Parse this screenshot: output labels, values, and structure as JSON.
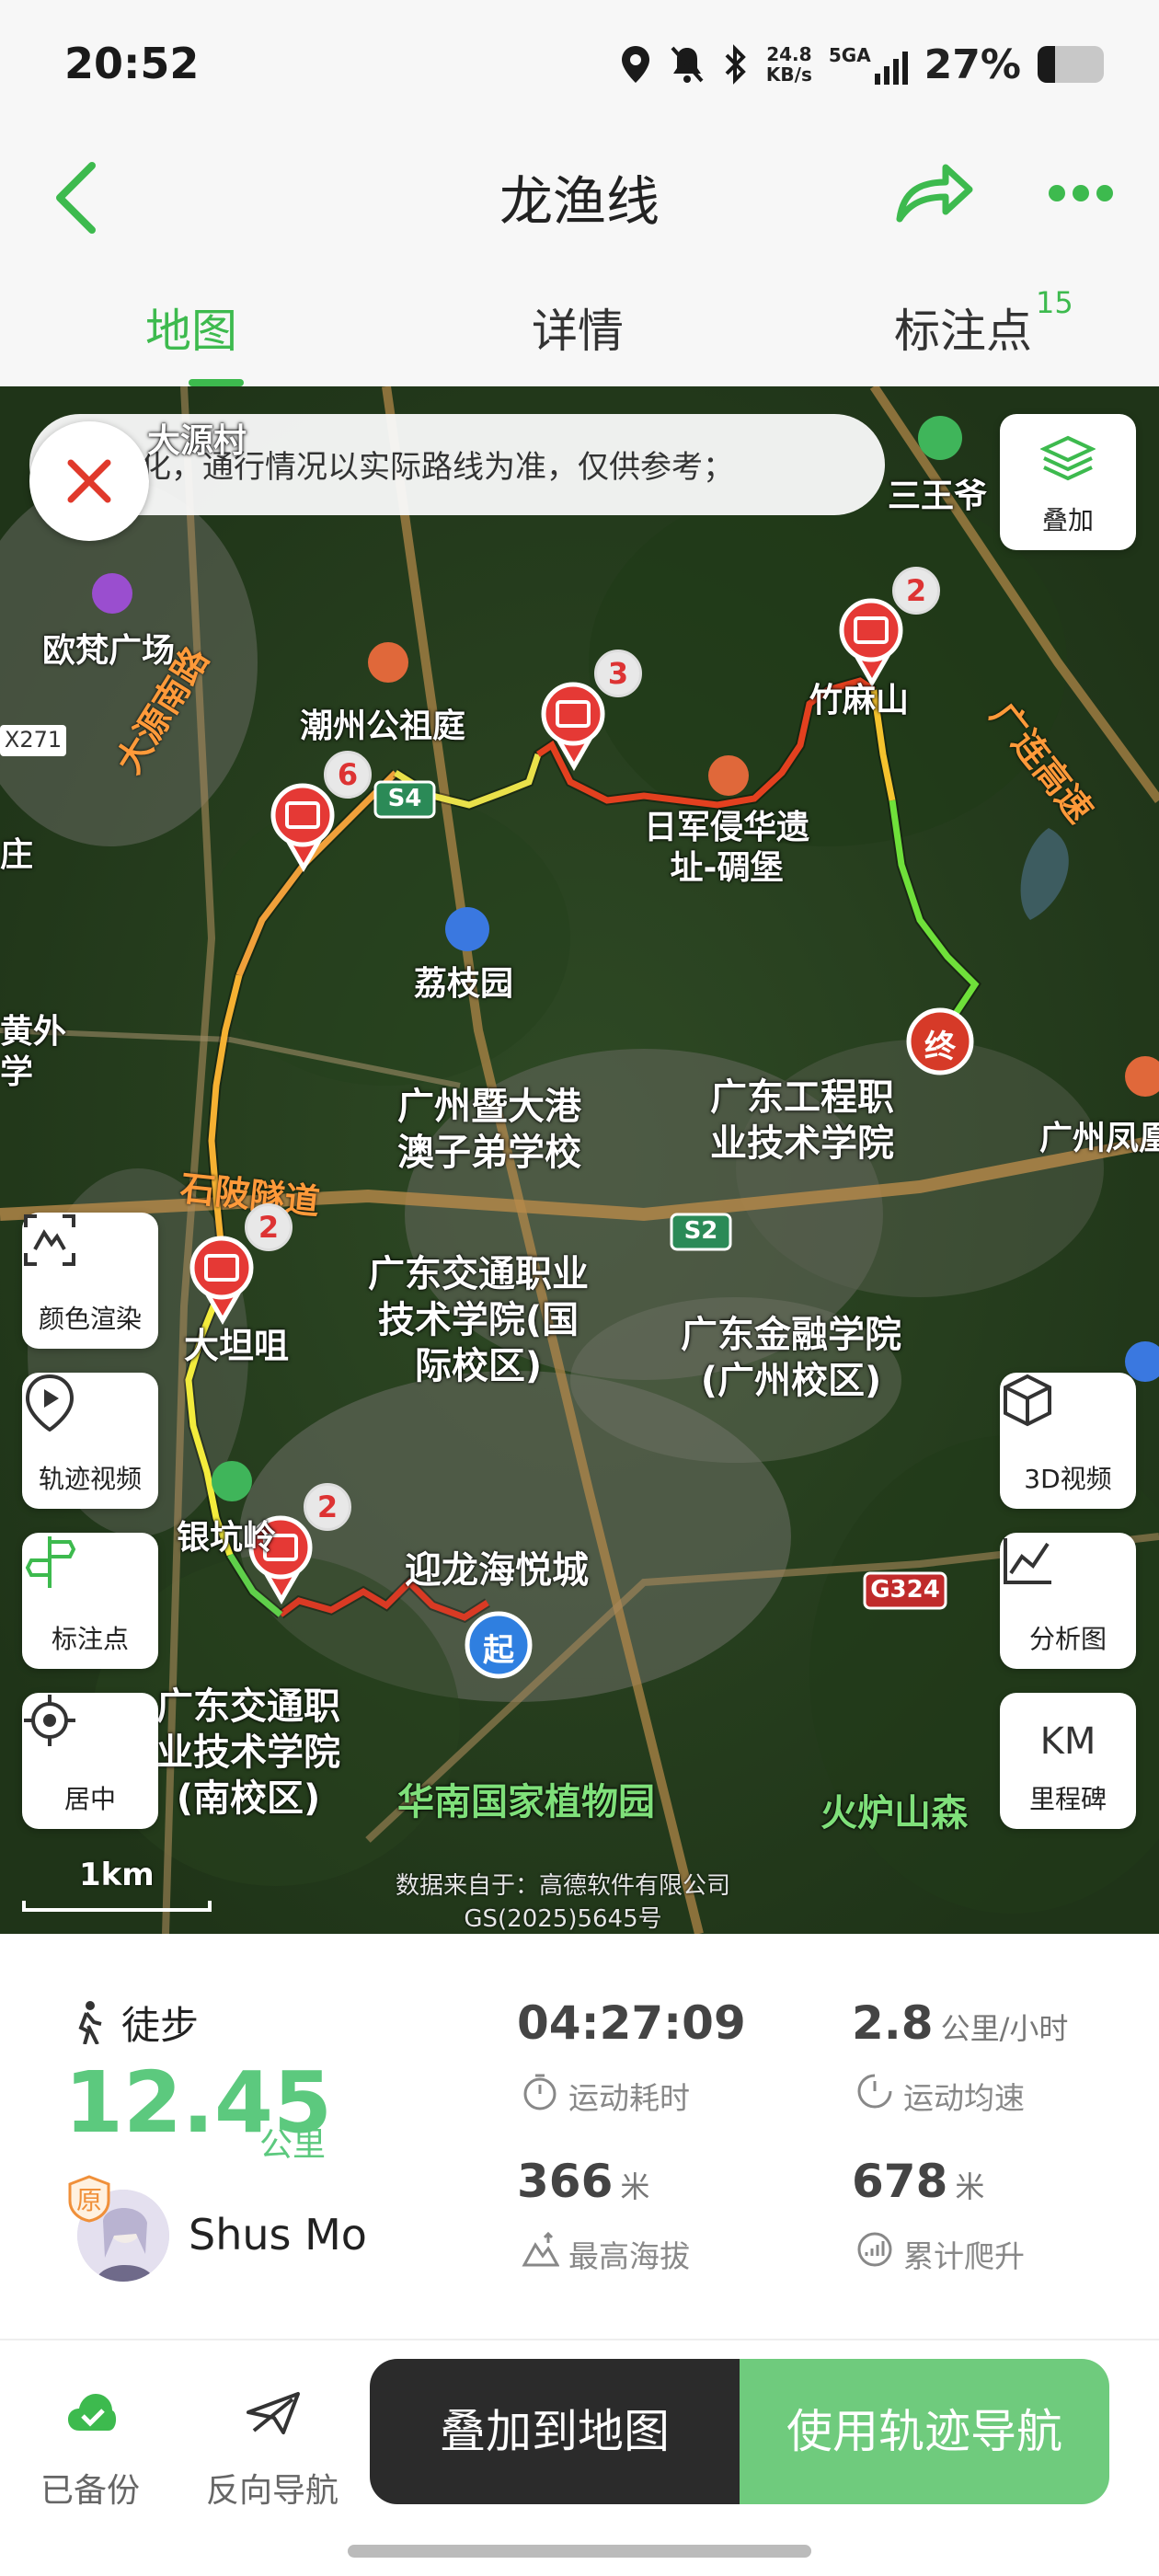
{
  "status": {
    "time": "20:52",
    "net_speed_value": "24.8",
    "net_speed_unit": "KB/s",
    "signal": "5GA",
    "battery": "27%",
    "battery_level": 0.27
  },
  "header": {
    "title": "龙渔线",
    "tabs": [
      {
        "label": "地图"
      },
      {
        "label": "详情"
      },
      {
        "label": "标注点"
      }
    ],
    "marks_count": "15",
    "accent": "#3dba4e"
  },
  "map": {
    "notice": "化，通行情况以实际路线为准，仅供参考；",
    "overlay_label": "叠加",
    "color_render_label": "颜色渲染",
    "track_video_label": "轨迹视频",
    "marks_label": "标注点",
    "center_label": "居中",
    "video3d_label": "3D视频",
    "analysis_label": "分析图",
    "milestone_km": "KM",
    "milestone_label": "里程碑",
    "scale": "1km",
    "credit_line1": "数据来自于：高德软件有限公司",
    "credit_line2": "GS(2025)5645号",
    "start_label": "起",
    "end_label": "终",
    "place_labels": {
      "dayuan_village": "大源村",
      "oufan": "欧梵广场",
      "sanwangye": "三王爷",
      "chaozhou": "潮州公祖庭",
      "jiaomashan": "竹麻山",
      "rijun": "日军侵华遗",
      "rijun2": "址-碉堡",
      "lizhiyuan": "荔枝园",
      "jinan": "广州暨大港",
      "jinan2": "澳子弟学校",
      "gdgc": "广东工程职",
      "gdgc2": "业技术学院",
      "fenghuang": "广州凤凰",
      "shiling": "石陂隧道",
      "dadanju": "大坦咀",
      "gdjt": "广东交通职业",
      "gdjt2": "技术学院(国",
      "gdjt3": "际校区)",
      "gdjr": "广东金融学院",
      "gdjr2": "(广州校区)",
      "yinkeng": "银坑岭",
      "yinglong": "迎龙海悦城",
      "gdjtn": "广东交通职",
      "gdjtn2": "业技术学院",
      "gdjtn3": "(南校区)",
      "huanan": "华南国家植物园",
      "huolu": "火炉山森",
      "dayuannan": "大源南路",
      "guanglian": "广连高速",
      "x271": "X271",
      "s4": "S4",
      "s2": "S2",
      "g324": "G324",
      "huangwai": "黄外",
      "xue": "学",
      "zhuang": "庄"
    },
    "pin_counts": [
      "2",
      "3",
      "6",
      "2",
      "2"
    ]
  },
  "stats": {
    "activity": "徒步",
    "distance": "12.45",
    "distance_unit": "公里",
    "user": "Shus Mo",
    "original_badge": "原",
    "duration": "04:27:09",
    "duration_label": "运动耗时",
    "avg_speed": "2.8",
    "avg_speed_unit": "公里/小时",
    "avg_speed_label": "运动均速",
    "max_alt": "366",
    "max_alt_unit": "米",
    "max_alt_label": "最高海拔",
    "climb": "678",
    "climb_unit": "米",
    "climb_label": "累计爬升"
  },
  "bottom": {
    "backup_label": "已备份",
    "reverse_label": "反向导航",
    "overlay_map": "叠加到地图",
    "use_nav": "使用轨迹导航"
  }
}
